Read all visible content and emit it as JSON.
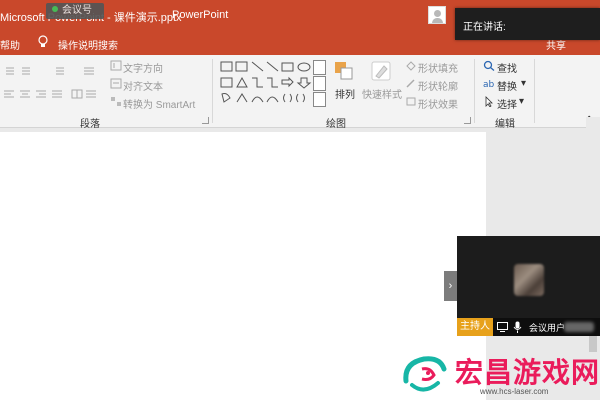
{
  "titlebar": {
    "title": "Microsoft PowerPoint - 课件演示.pptx",
    "app_name": "PowerPoint",
    "meeting_tag": "会议号"
  },
  "tabs": {
    "help": "帮助",
    "tell_me": "操作说明搜索",
    "share": "共享"
  },
  "speaking_panel": {
    "label": "正在讲话:"
  },
  "ribbon": {
    "paragraph": {
      "label": "段落",
      "text_direction": "文字方向",
      "align_text": "对齐文本",
      "convert_smartart": "转换为 SmartArt"
    },
    "drawing": {
      "label": "绘图",
      "arrange": "排列",
      "quick_styles": "快速样式",
      "shape_fill": "形状填充",
      "shape_outline": "形状轮廓",
      "shape_effects": "形状效果"
    },
    "editing": {
      "label": "编辑",
      "find": "查找",
      "replace": "替换",
      "select": "选择"
    }
  },
  "video_panel": {
    "host_badge": "主持人",
    "user_name": "会议用户"
  },
  "watermark": {
    "title": "宏昌游戏网",
    "url": "www.hcs-laser.com"
  },
  "colors": {
    "accent": "#c9482b",
    "host_badge": "#e7a11b",
    "watermark": "#ea1c5b"
  }
}
